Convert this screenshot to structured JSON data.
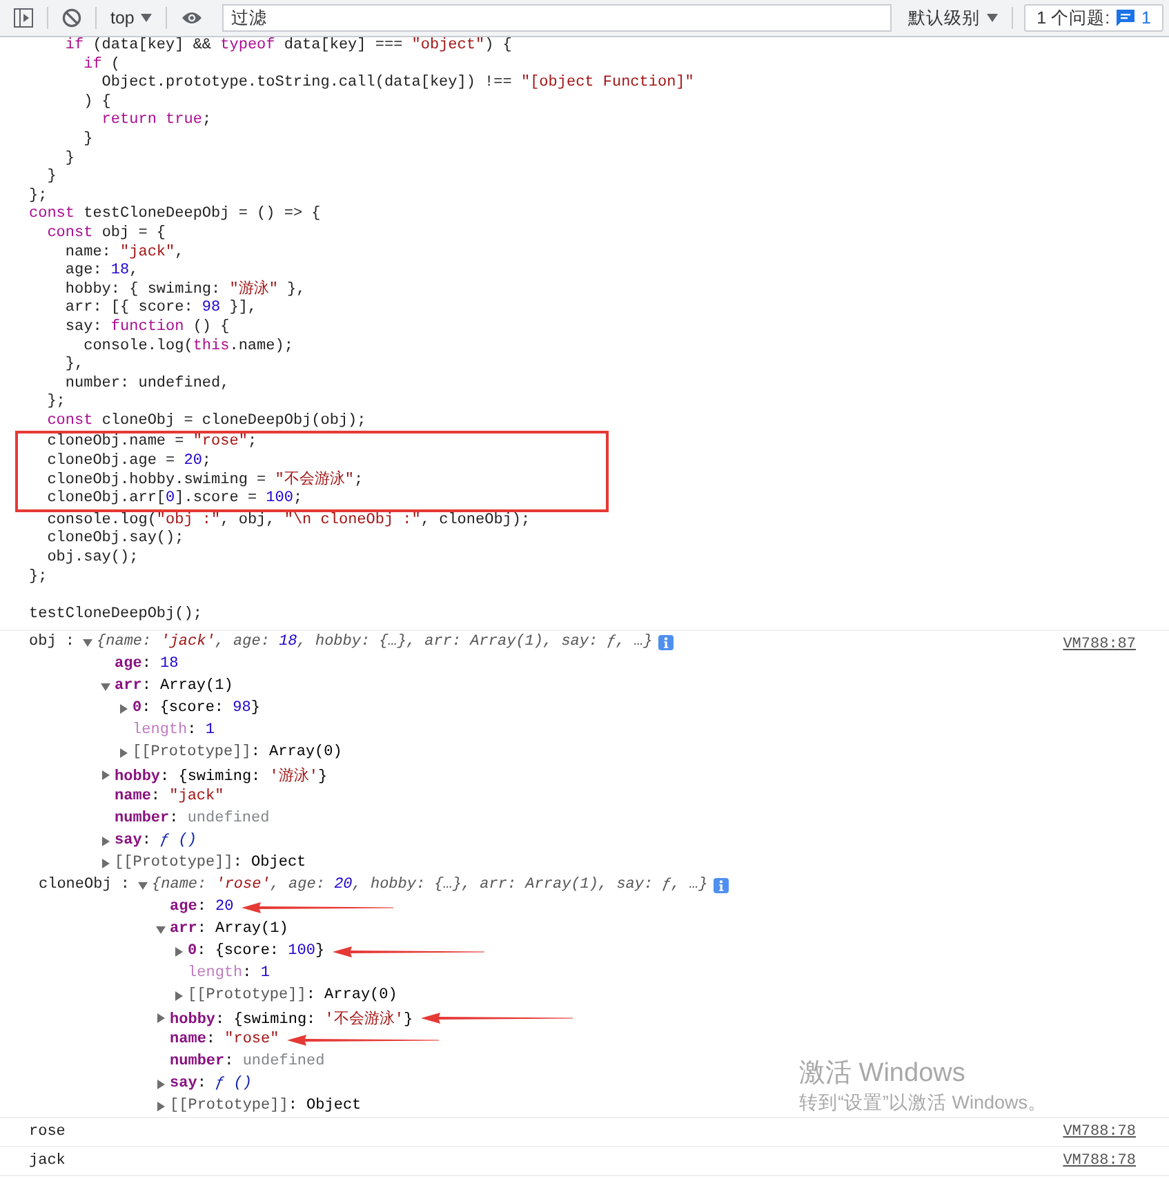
{
  "toolbar": {
    "context": "top",
    "filter": {
      "placeholder": "过滤"
    },
    "levels": "默认级别",
    "issues": {
      "label": "1 个问题:",
      "count": "1"
    }
  },
  "code_echo": {
    "groups": [
      {
        "boxed": false,
        "lines": [
          [
            {
              "kind": "kw",
              "text": "    if"
            },
            {
              "kind": "p",
              "text": " (data[key] && "
            },
            {
              "kind": "kw",
              "text": "typeof"
            },
            {
              "kind": "p",
              "text": " data[key] === "
            },
            {
              "kind": "str",
              "text": "\"object\""
            },
            {
              "kind": "p",
              "text": ") {"
            }
          ],
          [
            {
              "kind": "kw",
              "text": "      if"
            },
            {
              "kind": "p",
              "text": " ("
            }
          ],
          [
            {
              "kind": "p",
              "text": "        Object.prototype.toString.call(data[key]) !== "
            },
            {
              "kind": "str",
              "text": "\"[object Function]\""
            }
          ],
          [
            {
              "kind": "p",
              "text": "      ) {"
            }
          ],
          [
            {
              "kind": "kw",
              "text": "        return"
            },
            {
              "kind": "kw",
              "text": " true"
            },
            {
              "kind": "p",
              "text": ";"
            }
          ],
          [
            {
              "kind": "p",
              "text": "      }"
            }
          ],
          [
            {
              "kind": "p",
              "text": "    }"
            }
          ],
          [
            {
              "kind": "p",
              "text": "  }"
            }
          ],
          [
            {
              "kind": "p",
              "text": "};"
            }
          ],
          [
            {
              "kind": "kw",
              "text": "const"
            },
            {
              "kind": "p",
              "text": " testCloneDeepObj = () => {"
            }
          ],
          [
            {
              "kind": "kw",
              "text": "  const"
            },
            {
              "kind": "p",
              "text": " obj = {"
            }
          ],
          [
            {
              "kind": "p",
              "text": "    name: "
            },
            {
              "kind": "str",
              "text": "\"jack\""
            },
            {
              "kind": "p",
              "text": ","
            }
          ],
          [
            {
              "kind": "p",
              "text": "    age: "
            },
            {
              "kind": "num",
              "text": "18"
            },
            {
              "kind": "p",
              "text": ","
            }
          ],
          [
            {
              "kind": "p",
              "text": "    hobby: { swiming: "
            },
            {
              "kind": "str",
              "text": "\"游泳\""
            },
            {
              "kind": "p",
              "text": " },"
            }
          ],
          [
            {
              "kind": "p",
              "text": "    arr: [{ score: "
            },
            {
              "kind": "num",
              "text": "98"
            },
            {
              "kind": "p",
              "text": " }],"
            }
          ],
          [
            {
              "kind": "p",
              "text": "    say: "
            },
            {
              "kind": "kw",
              "text": "function"
            },
            {
              "kind": "p",
              "text": " () {"
            }
          ],
          [
            {
              "kind": "p",
              "text": "      console.log("
            },
            {
              "kind": "kw",
              "text": "this"
            },
            {
              "kind": "p",
              "text": ".name);"
            }
          ],
          [
            {
              "kind": "p",
              "text": "    },"
            }
          ],
          [
            {
              "kind": "p",
              "text": "    number: undefined,"
            }
          ],
          [
            {
              "kind": "p",
              "text": "  };"
            }
          ],
          [
            {
              "kind": "kw",
              "text": "  const"
            },
            {
              "kind": "p",
              "text": " cloneObj = cloneDeepObj(obj);"
            }
          ]
        ]
      },
      {
        "boxed": true,
        "lines": [
          [
            {
              "kind": "p",
              "text": "  cloneObj.name = "
            },
            {
              "kind": "str",
              "text": "\"rose\""
            },
            {
              "kind": "p",
              "text": ";"
            }
          ],
          [
            {
              "kind": "p",
              "text": "  cloneObj.age = "
            },
            {
              "kind": "num",
              "text": "20"
            },
            {
              "kind": "p",
              "text": ";"
            }
          ],
          [
            {
              "kind": "p",
              "text": "  cloneObj.hobby.swiming = "
            },
            {
              "kind": "str",
              "text": "\"不会游泳\""
            },
            {
              "kind": "p",
              "text": ";"
            }
          ],
          [
            {
              "kind": "p",
              "text": "  cloneObj.arr["
            },
            {
              "kind": "num",
              "text": "0"
            },
            {
              "kind": "p",
              "text": "].score = "
            },
            {
              "kind": "num",
              "text": "100"
            },
            {
              "kind": "p",
              "text": ";"
            }
          ]
        ]
      },
      {
        "boxed": false,
        "lines": [
          [
            {
              "kind": "p",
              "text": "  console.log("
            },
            {
              "kind": "str",
              "text": "\"obj :\""
            },
            {
              "kind": "p",
              "text": ", obj, "
            },
            {
              "kind": "str",
              "text": "\"\\n cloneObj :\""
            },
            {
              "kind": "p",
              "text": ", cloneObj);"
            }
          ],
          [
            {
              "kind": "p",
              "text": "  cloneObj.say();"
            }
          ],
          [
            {
              "kind": "p",
              "text": "  obj.say();"
            }
          ],
          [
            {
              "kind": "p",
              "text": "};"
            }
          ]
        ]
      },
      {
        "boxed": false,
        "lines": [
          [
            {
              "kind": "p",
              "text": "testCloneDeepObj();"
            }
          ]
        ]
      }
    ]
  },
  "messages": [
    {
      "kind": "objects",
      "source": "VM788:87",
      "parts": [
        {
          "label": "obj :",
          "object": {
            "expanded": true,
            "summary": [
              {
                "kind": "p",
                "text": "{name: "
              },
              {
                "kind": "str",
                "text": "'jack'"
              },
              {
                "kind": "p",
                "text": ", age: "
              },
              {
                "kind": "num",
                "text": "18"
              },
              {
                "kind": "p",
                "text": ", hobby: {…}, arr: Array(1), say: ƒ, …}"
              }
            ],
            "children": [
              {
                "kind": "own",
                "key": "age",
                "value": [
                  {
                    "kind": "p",
                    "text": ": "
                  },
                  {
                    "kind": "num",
                    "text": "18"
                  }
                ],
                "pointed": false
              },
              {
                "kind": "own",
                "key": "arr",
                "value": [
                  {
                    "kind": "p",
                    "text": ": Array(1)"
                  }
                ],
                "expanded": true,
                "pointed": false,
                "children": [
                  {
                    "kind": "own",
                    "key": "0",
                    "value": [
                      {
                        "kind": "p",
                        "text": ": {score: "
                      },
                      {
                        "kind": "num",
                        "text": "98"
                      },
                      {
                        "kind": "p",
                        "text": "}"
                      }
                    ],
                    "expanded": false,
                    "pointed": false
                  },
                  {
                    "kind": "hidden",
                    "key": "length",
                    "value": [
                      {
                        "kind": "p",
                        "text": ": "
                      },
                      {
                        "kind": "num",
                        "text": "1"
                      }
                    ],
                    "pointed": false
                  },
                  {
                    "kind": "internal",
                    "key": "[[Prototype]]",
                    "value": [
                      {
                        "kind": "p",
                        "text": ": Array(0)"
                      }
                    ],
                    "expanded": false,
                    "pointed": false
                  }
                ]
              },
              {
                "kind": "own",
                "key": "hobby",
                "value": [
                  {
                    "kind": "p",
                    "text": ": {swiming: "
                  },
                  {
                    "kind": "str",
                    "text": "'游泳'"
                  },
                  {
                    "kind": "p",
                    "text": "}"
                  }
                ],
                "expanded": false,
                "pointed": false
              },
              {
                "kind": "own",
                "key": "name",
                "value": [
                  {
                    "kind": "p",
                    "text": ": "
                  },
                  {
                    "kind": "str",
                    "text": "\"jack\""
                  }
                ],
                "pointed": false
              },
              {
                "kind": "own",
                "key": "number",
                "value": [
                  {
                    "kind": "p",
                    "text": ": "
                  },
                  {
                    "kind": "undef",
                    "text": "undefined"
                  }
                ],
                "pointed": false
              },
              {
                "kind": "own",
                "key": "say",
                "value": [
                  {
                    "kind": "p",
                    "text": ": "
                  },
                  {
                    "kind": "fn",
                    "text": "ƒ ()"
                  }
                ],
                "expanded": false,
                "pointed": false
              },
              {
                "kind": "internal",
                "key": "[[Prototype]]",
                "value": [
                  {
                    "kind": "p",
                    "text": ": Object"
                  }
                ],
                "expanded": false,
                "pointed": false
              }
            ]
          }
        },
        {
          "label": "cloneObj :",
          "object": {
            "expanded": true,
            "summary": [
              {
                "kind": "p",
                "text": "{name: "
              },
              {
                "kind": "str",
                "text": "'rose'"
              },
              {
                "kind": "p",
                "text": ", age: "
              },
              {
                "kind": "num",
                "text": "20"
              },
              {
                "kind": "p",
                "text": ", hobby: {…}, arr: Array(1), say: ƒ, …}"
              }
            ],
            "children": [
              {
                "kind": "own",
                "key": "age",
                "value": [
                  {
                    "kind": "p",
                    "text": ": "
                  },
                  {
                    "kind": "num",
                    "text": "20"
                  }
                ],
                "pointed": true
              },
              {
                "kind": "own",
                "key": "arr",
                "value": [
                  {
                    "kind": "p",
                    "text": ": Array(1)"
                  }
                ],
                "expanded": true,
                "pointed": false,
                "children": [
                  {
                    "kind": "own",
                    "key": "0",
                    "value": [
                      {
                        "kind": "p",
                        "text": ": {score: "
                      },
                      {
                        "kind": "num",
                        "text": "100"
                      },
                      {
                        "kind": "p",
                        "text": "}"
                      }
                    ],
                    "expanded": false,
                    "pointed": true
                  },
                  {
                    "kind": "hidden",
                    "key": "length",
                    "value": [
                      {
                        "kind": "p",
                        "text": ": "
                      },
                      {
                        "kind": "num",
                        "text": "1"
                      }
                    ],
                    "pointed": false
                  },
                  {
                    "kind": "internal",
                    "key": "[[Prototype]]",
                    "value": [
                      {
                        "kind": "p",
                        "text": ": Array(0)"
                      }
                    ],
                    "expanded": false,
                    "pointed": false
                  }
                ]
              },
              {
                "kind": "own",
                "key": "hobby",
                "value": [
                  {
                    "kind": "p",
                    "text": ": {swiming: "
                  },
                  {
                    "kind": "str",
                    "text": "'不会游泳'"
                  },
                  {
                    "kind": "p",
                    "text": "}"
                  }
                ],
                "expanded": false,
                "pointed": true
              },
              {
                "kind": "own",
                "key": "name",
                "value": [
                  {
                    "kind": "p",
                    "text": ": "
                  },
                  {
                    "kind": "str",
                    "text": "\"rose\""
                  }
                ],
                "pointed": true
              },
              {
                "kind": "own",
                "key": "number",
                "value": [
                  {
                    "kind": "p",
                    "text": ": "
                  },
                  {
                    "kind": "undef",
                    "text": "undefined"
                  }
                ],
                "pointed": false
              },
              {
                "kind": "own",
                "key": "say",
                "value": [
                  {
                    "kind": "p",
                    "text": ": "
                  },
                  {
                    "kind": "fn",
                    "text": "ƒ ()"
                  }
                ],
                "expanded": false,
                "pointed": false
              },
              {
                "kind": "internal",
                "key": "[[Prototype]]",
                "value": [
                  {
                    "kind": "p",
                    "text": ": Object"
                  }
                ],
                "expanded": false,
                "pointed": false
              }
            ]
          }
        }
      ]
    },
    {
      "kind": "text",
      "text": "rose",
      "source": "VM788:78"
    },
    {
      "kind": "text",
      "text": "jack",
      "source": "VM788:78"
    }
  ],
  "os_notice": {
    "title": "激活 Windows",
    "subtitle": "转到“设置”以激活 Windows。"
  }
}
